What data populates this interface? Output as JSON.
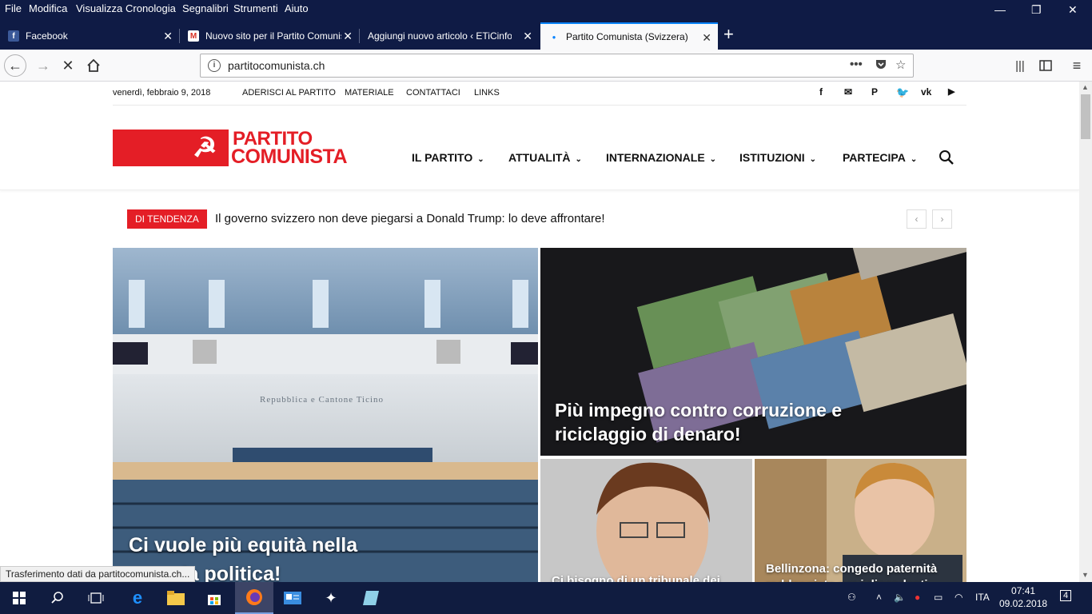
{
  "menubar": {
    "items": [
      "File",
      "Modifica",
      "Visualizza",
      "Cronologia",
      "Segnalibri",
      "Strumenti",
      "Aiuto"
    ],
    "window_controls": [
      "minimize",
      "restore",
      "close"
    ]
  },
  "tabs": [
    {
      "title": "Facebook",
      "icon": "facebook-icon",
      "active": false
    },
    {
      "title": "Nuovo sito per il Partito Comunista",
      "icon": "gmail-icon",
      "active": false
    },
    {
      "title": "Aggiungi nuovo articolo ‹ ETiCinfo",
      "icon": "wordpress-icon",
      "active": false
    },
    {
      "title": "Partito Comunista (Svizzera) | C",
      "icon": "loading-icon",
      "active": true
    }
  ],
  "navbar": {
    "url": "partitocomunista.ch",
    "icons": [
      "back-icon",
      "forward-icon",
      "stop-icon",
      "home-icon",
      "page-actions-icon",
      "pocket-icon",
      "bookmark-star-icon",
      "library-icon",
      "sidebar-icon",
      "hamburger-menu-icon"
    ]
  },
  "site": {
    "date": "venerdì, febbraio 9, 2018",
    "top_links": [
      "ADERISCI AL PARTITO",
      "MATERIALE",
      "CONTATTACI",
      "LINKS"
    ],
    "social_icons": [
      "facebook-icon",
      "mail-icon",
      "paypal-icon",
      "twitter-icon",
      "vk-icon",
      "youtube-icon"
    ],
    "logo": {
      "line1": "PARTITO",
      "line2": "COMUNISTA",
      "symbol": "☭"
    },
    "nav": [
      "IL PARTITO",
      "ATTUALITÀ",
      "INTERNAZIONALE",
      "ISTITUZIONI",
      "PARTECIPA"
    ],
    "trending": {
      "label": "DI TENDENZA",
      "headline": "Il governo svizzero non deve piegarsi a Donald Trump: lo deve affrontare!",
      "prev": "‹",
      "next": "›"
    },
    "articles": [
      {
        "title": "Ci vuole più equità nella agenda politica!",
        "image_caption": "Repubblica e Cantone Ticino"
      },
      {
        "title": "Più impegno contro corruzione e riciclaggio di denaro!"
      },
      {
        "title": "Ci bisogno di un tribunale dei"
      },
      {
        "title": "Bellinzona: congedo paternità raddoppiato per i dipendenti"
      }
    ]
  },
  "statusbar": {
    "text": "Trasferimento dati da partitocomunista.ch..."
  },
  "taskbar": {
    "language": "ITA",
    "time": "07:41",
    "date": "09.02.2018",
    "notifications": "4"
  },
  "colors": {
    "brand_red": "#e41e26",
    "chrome_dark": "#0f1b45",
    "accent_blue": "#0a84ff"
  }
}
